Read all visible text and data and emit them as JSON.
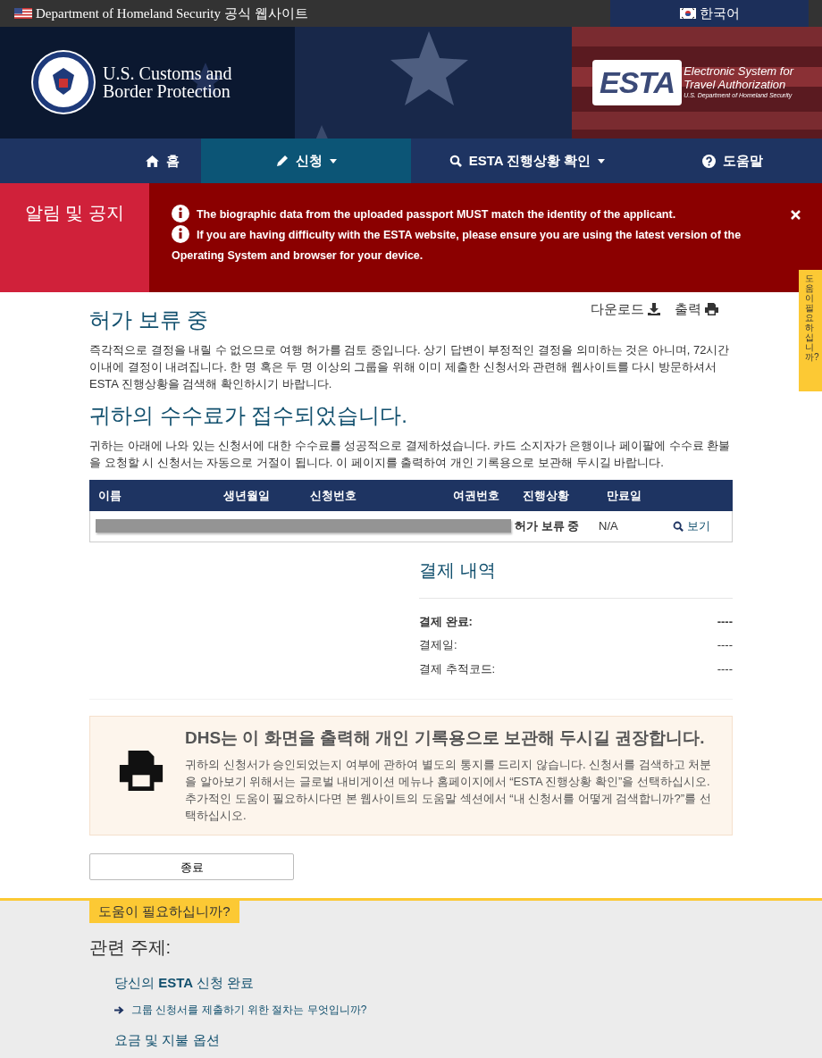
{
  "top_bar": {
    "agency_text": "Department of Homeland Security 공식 웹사이트",
    "language": "한국어"
  },
  "header": {
    "agency_name_lines": [
      "U.S. Customs and",
      "Border Protection"
    ],
    "esta_logo": {
      "mark": "ESTA",
      "lines": [
        "Electronic System for",
        "Travel Authorization"
      ],
      "subline": "U.S. Department of Homeland Security"
    }
  },
  "nav": [
    {
      "label": "홈",
      "kind": "home",
      "dropdown": false,
      "selected": false
    },
    {
      "label": "신청",
      "kind": "apply",
      "dropdown": true,
      "selected": true
    },
    {
      "label": "ESTA 진행상황 확인",
      "kind": "status",
      "dropdown": true,
      "selected": false
    },
    {
      "label": "도움말",
      "kind": "help",
      "dropdown": false,
      "selected": false
    }
  ],
  "notices": {
    "title": "알림 및 공지",
    "messages": [
      "The biographic data from the uploaded passport MUST match the identity of the applicant.",
      "If you are having difficulty with the ESTA website, please ensure you are using the latest version of the Operating System and browser for your device."
    ]
  },
  "side_tab": "도움이 필요하십니까?",
  "status": {
    "title": "허가 보류 중",
    "download": "다운로드",
    "print": "출력",
    "text": "즉각적으로 결정을 내릴 수 없으므로 여행 허가를 검토 중입니다. 상기 답변이 부정적인 결정을 의미하는 것은 아니며, 72시간 이내에 결정이 내려집니다. 한 명 혹은 두 명 이상의 그룹을 위해 이미 제출한 신청서와 관련해 웹사이트를 다시 방문하셔서 ESTA 진행상황을 검색해 확인하시기 바랍니다."
  },
  "fee": {
    "title": "귀하의 수수료가 접수되었습니다.",
    "text": "귀하는 아래에 나와 있는 신청서에 대한 수수료를 성공적으로 결제하셨습니다. 카드 소지자가 은행이나 페이팔에 수수료 환불을 요청할 시 신청서는 자동으로 거절이 됩니다. 이 페이지를 출력하여 개인 기록용으로 보관해 두시길 바랍니다."
  },
  "table": {
    "columns": [
      "이름",
      "생년월일",
      "신청번호",
      "여권번호",
      "진행상황",
      "만료일"
    ],
    "rows": [
      {
        "redacted": true,
        "status": "허가 보류 중",
        "expiry": "N/A",
        "action": "보기"
      }
    ]
  },
  "payment": {
    "title": "결제 내역",
    "rows": [
      {
        "label": "결제 완료:",
        "value": "----",
        "bold": true
      },
      {
        "label": "결제일:",
        "value": "----",
        "bold": false
      },
      {
        "label": "결제 추적코드:",
        "value": "----",
        "bold": false
      }
    ]
  },
  "print_notice": {
    "title": "DHS는 이 화면을 출력해 개인 기록용으로 보관해 두시길 권장합니다.",
    "text": "귀하의 신청서가 승인되었는지 여부에 관하여 별도의 통지를 드리지 않습니다. 신청서를 검색하고 처분을 알아보기 위해서는 글로벌 내비게이션 메뉴나 홈페이지에서 “ESTA 진행상황 확인”을 선택하십시오. 추가적인 도움이 필요하시다면 본 웹사이트의 도움말 섹션에서 “내 신청서를 어떻게 검색합니까?”를 선택하십시오."
  },
  "close_button": "종료",
  "help": {
    "tab": "도움이 필요하십니까?",
    "title": "관련 주제:",
    "topics": [
      {
        "text": "당신의 **ESTA** 신청 완료",
        "children": [
          {
            "text": "그룹 신청서를 제출하기 위한 절차는 무엇입니까?"
          }
        ]
      },
      {
        "text": "요금 및 지불 옵션"
      }
    ]
  }
}
